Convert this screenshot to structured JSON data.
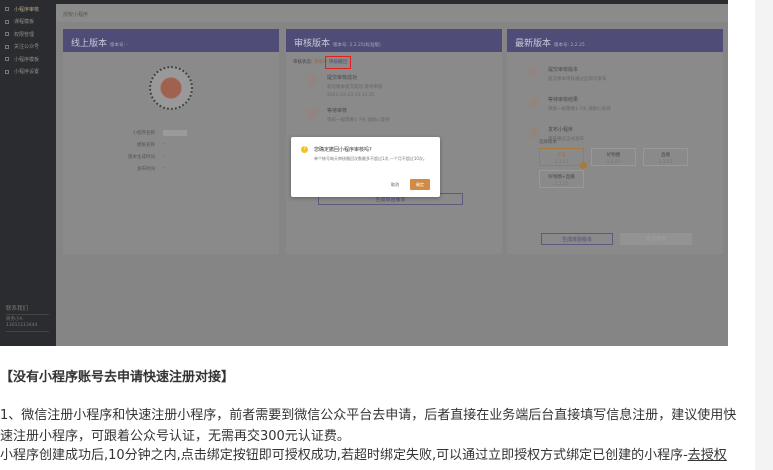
{
  "screenshot": {
    "sidebar": {
      "items": [
        "小程序审核",
        "课程模板",
        "权限管理",
        "关注公众号",
        "小程序模板",
        "小程序设置"
      ],
      "contact_title": "联系我们",
      "contact_name": "商务小A",
      "contact_phone": "13011113444"
    },
    "header": "授权小程序",
    "online": {
      "title": "线上版本",
      "version": "版本号: -",
      "fields": [
        {
          "label": "小程序名称",
          "value": ""
        },
        {
          "label": "模板名称",
          "value": "-"
        },
        {
          "label": "版本生成时间",
          "value": "-"
        },
        {
          "label": "发布时间",
          "value": "-"
        }
      ]
    },
    "audit": {
      "title": "审核版本",
      "version": "版本号: 2.2.25(标准版)",
      "status_label": "审核状态:",
      "status": "审核中",
      "withdraw": "审核撤回",
      "steps": [
        {
          "n": "1",
          "title": "提交审核成功",
          "desc": "新的版本提交成功,等待审核",
          "time": "2021-03-23 15:12:25"
        },
        {
          "n": "2",
          "title": "等待审核",
          "desc": "审核一般需要1-7天,请耐心等待"
        }
      ],
      "button": "生成体验版本"
    },
    "latest": {
      "title": "最新版本",
      "version": "版本号: 2.2.25",
      "steps": [
        {
          "n": "1",
          "title": "提交审核版本",
          "desc": "提交版本审核通过后即可发布"
        },
        {
          "n": "2",
          "title": "等待审核结果",
          "desc": "审核一般需要1-7天,请耐心等待"
        },
        {
          "n": "3",
          "title": "发布小程序",
          "desc": "审核通过正式发布"
        }
      ],
      "select_label": "选择版本",
      "versions": [
        {
          "name": "标准",
          "v": "2.2.25"
        },
        {
          "name": "好物圈",
          "v": "2.2.25"
        },
        {
          "name": "直播",
          "v": "2.2.25"
        },
        {
          "name": "好物圈+直播",
          "v": "2.2.25"
        }
      ],
      "btn_trial": "生成体验版本",
      "btn_submit": "提交审核"
    },
    "dialog": {
      "title": "您确定撤回小程序审核吗?",
      "message": "单个帐号每天审核撤回次数最多不超过1次,一个月不超过10次。",
      "cancel": "取消",
      "ok": "确定"
    }
  },
  "article": {
    "heading": "【没有小程序账号去申请快速注册对接】",
    "p1_line1": "1、微信注册小程序和快速注册小程序，前者需要到微信公众平台去申请，后者直接在业务端后台直接填写信息注册，建议使用快",
    "p1_line2": "速注册小程序，可跟着公众号认证，无需再交300元认证费。",
    "p2": "小程序创建成功后,10分钟之内,点击绑定按钮即可授权成功,若超时绑定失败,可以通过立即授权方式绑定已创建的小程序-",
    "p2_link": "去授权"
  }
}
